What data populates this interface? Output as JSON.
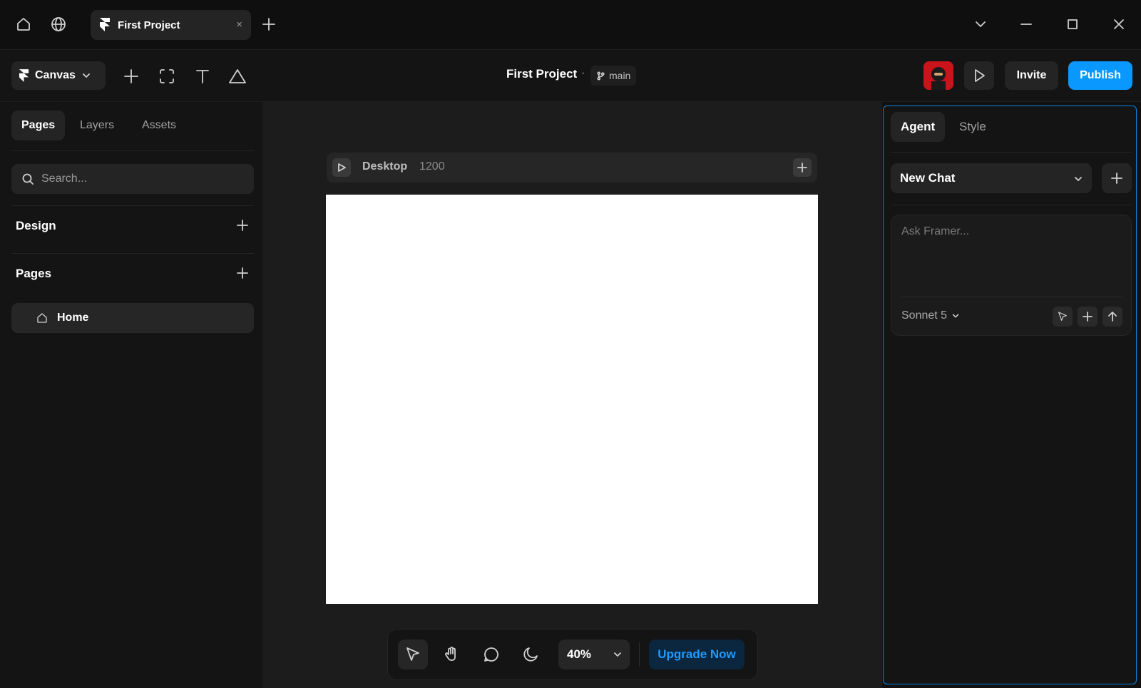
{
  "titlebar": {
    "tab_title": "First Project",
    "close_glyph": "×"
  },
  "toolbar": {
    "canvas_label": "Canvas",
    "project_title": "First Project",
    "separator": "·",
    "branch": "main",
    "invite_label": "Invite",
    "publish_label": "Publish"
  },
  "left_panel": {
    "tabs": [
      "Pages",
      "Layers",
      "Assets"
    ],
    "active_tab": "Pages",
    "search_placeholder": "Search...",
    "design_title": "Design",
    "pages_title": "Pages",
    "pages": [
      {
        "label": "Home",
        "icon": "home-icon"
      }
    ]
  },
  "canvas": {
    "frame_name": "Desktop",
    "frame_width": "1200"
  },
  "bottom_bar": {
    "zoom": "40%",
    "upgrade_label": "Upgrade Now"
  },
  "right_panel": {
    "tabs": [
      "Agent",
      "Style"
    ],
    "active_tab": "Agent",
    "chat_title": "New Chat",
    "input_placeholder": "Ask Framer...",
    "model": "Sonnet 5"
  },
  "colors": {
    "accent": "#0a98ff",
    "background": "#141414",
    "surface": "#242424",
    "canvas_bg": "#1c1c1c",
    "upgrade_text": "#1e9bff"
  }
}
